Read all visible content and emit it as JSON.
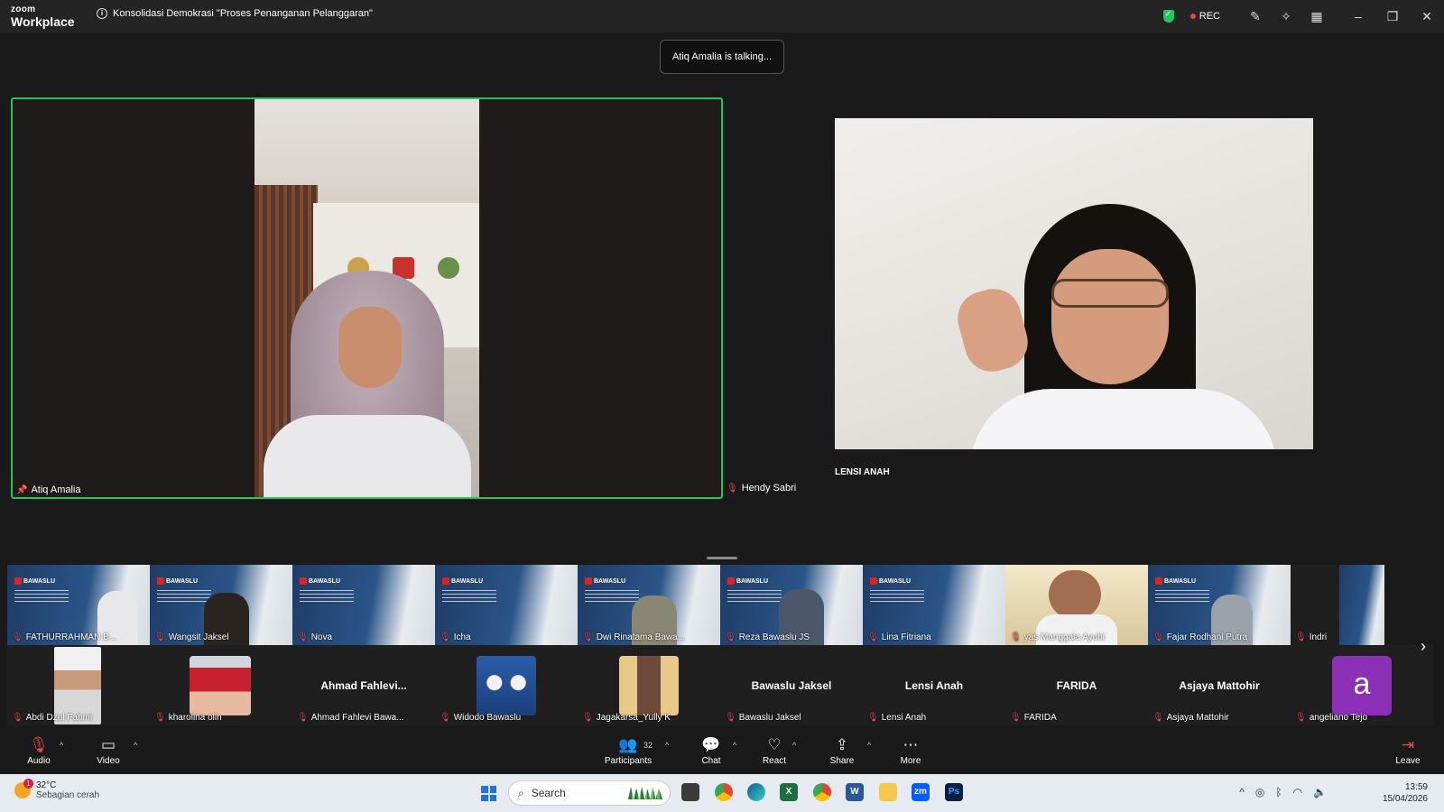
{
  "titlebar": {
    "logo_top": "zoom",
    "logo_bottom": "Workplace",
    "meeting_title": "Konsolidasi Demokrasi \"Proses Penanganan Pelanggaran\"",
    "rec_label": "REC",
    "security_color": "#23c55e"
  },
  "toast": {
    "text": "Atiq Amalia is talking..."
  },
  "main_tiles": {
    "active_speaker": "Atiq Amalia",
    "hendy_label": "Hendy Sabri",
    "lensi_label": "LENSI ANAH",
    "active_border_color": "#21c55d"
  },
  "gallery": {
    "row1": [
      {
        "name": "FATHURRAHMAN B..."
      },
      {
        "name": "Wangsit Jaksel"
      },
      {
        "name": "Nova"
      },
      {
        "name": "Icha"
      },
      {
        "name": "Dwi Rinatama Bawa..."
      },
      {
        "name": "Reza Bawaslu JS"
      },
      {
        "name": "Lina Fitriana"
      },
      {
        "name": "yas Manggala Ayubi"
      },
      {
        "name": "Fajar Rodhani Putra"
      },
      {
        "name": "Indri"
      }
    ],
    "row2": [
      {
        "name": "Abdi Dzul Fahmi",
        "display": ""
      },
      {
        "name": "kharolina olin",
        "display": ""
      },
      {
        "name": "Ahmad Fahlevi Bawa...",
        "display": "Ahmad  Fahlevi..."
      },
      {
        "name": "Widodo Bawaslu",
        "display": ""
      },
      {
        "name": "Jagakarsa_Yully K",
        "display": ""
      },
      {
        "name": "Bawaslu Jaksel",
        "display": "Bawaslu Jaksel"
      },
      {
        "name": "Lensi Anah",
        "display": "Lensi Anah"
      },
      {
        "name": "FARIDA",
        "display": "FARIDA"
      },
      {
        "name": "Asjaya Mattohir",
        "display": "Asjaya Mattohir"
      },
      {
        "name": "angeliano Tejo",
        "display": "a"
      }
    ],
    "bawaslu_text": "BAWASLU"
  },
  "toolbar": {
    "audio": "Audio",
    "video": "Video",
    "participants": "Participants",
    "participant_count": "32",
    "chat": "Chat",
    "react": "React",
    "share": "Share",
    "more": "More",
    "leave": "Leave"
  },
  "taskbar": {
    "temperature": "32°C",
    "weather": "Sebagian cerah",
    "weather_badge": "1",
    "search_placeholder": "Search",
    "time": "13:59",
    "date": "15/04/2026"
  }
}
